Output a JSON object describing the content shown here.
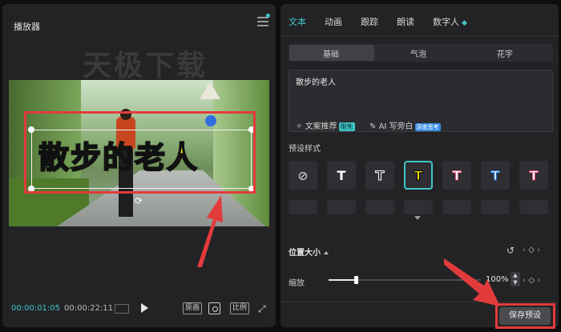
{
  "player": {
    "title": "播放器",
    "watermark": "天极下载",
    "caption": "散步的老人",
    "time_current": "00:00:01:05",
    "time_total": "00:00:22:11",
    "btn_original": "原画",
    "btn_ratio": "比例"
  },
  "panel": {
    "tabs": [
      "文本",
      "动画",
      "跟踪",
      "朗读",
      "数字人"
    ],
    "subtabs": [
      "基础",
      "气泡",
      "花字"
    ],
    "text_value": "散步的老人",
    "recommend_label": "文案推荐",
    "recommend_badge": "限免",
    "ai_label": "AI 写旁白",
    "ai_badge": "深度思考",
    "preset_label": "预设样式",
    "position_size_label": "位置大小",
    "scale_label": "缩放",
    "scale_value": "100%",
    "scale_fraction": 0.18,
    "save_label": "保存预设"
  },
  "colors": {
    "accent": "#3ec6c8",
    "highlight_red": "#e23b3b",
    "caption_yellow": "#ffe600"
  }
}
